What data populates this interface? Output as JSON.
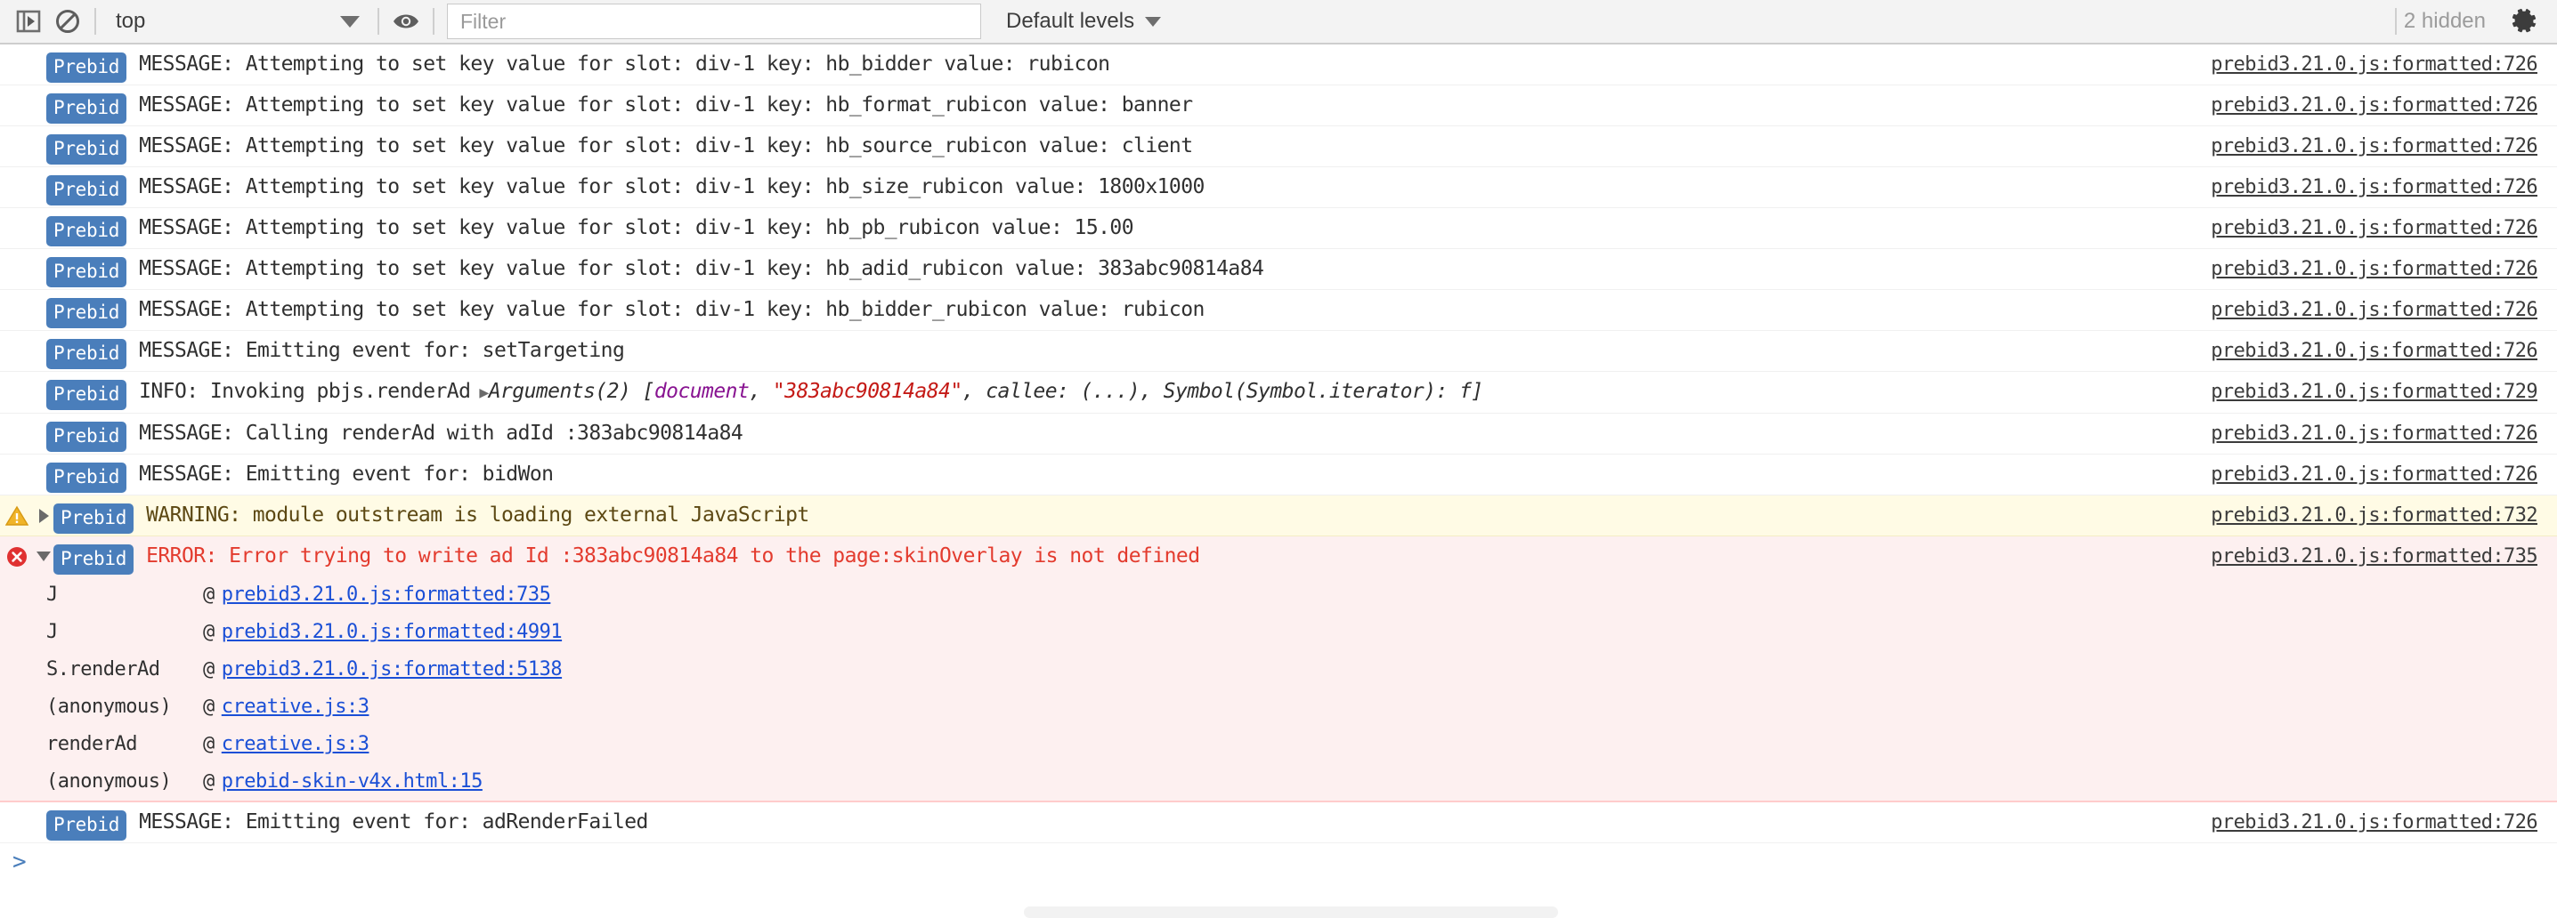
{
  "toolbar": {
    "sidebar_toggle_icon": "panel-open-icon",
    "clear_console_icon": "clear-console-icon",
    "context_value": "top",
    "eye_icon": "live-expression-eye-icon",
    "filter_placeholder": "Filter",
    "filter_value": "",
    "levels_label": "Default levels",
    "hidden_label": "2 hidden",
    "settings_icon": "gear-icon"
  },
  "console": {
    "badge_label": "Prebid",
    "prompt_glyph": ">",
    "rows": [
      {
        "level": "message",
        "text": "MESSAGE: Attempting to set key value for slot: div-1 key: hb_bidder value: rubicon",
        "source": "prebid3.21.0.js:formatted:726"
      },
      {
        "level": "message",
        "text": "MESSAGE: Attempting to set key value for slot: div-1 key: hb_format_rubicon value: banner",
        "source": "prebid3.21.0.js:formatted:726"
      },
      {
        "level": "message",
        "text": "MESSAGE: Attempting to set key value for slot: div-1 key: hb_source_rubicon value: client",
        "source": "prebid3.21.0.js:formatted:726"
      },
      {
        "level": "message",
        "text": "MESSAGE: Attempting to set key value for slot: div-1 key: hb_size_rubicon value: 1800x1000",
        "source": "prebid3.21.0.js:formatted:726"
      },
      {
        "level": "message",
        "text": "MESSAGE: Attempting to set key value for slot: div-1 key: hb_pb_rubicon value: 15.00",
        "source": "prebid3.21.0.js:formatted:726"
      },
      {
        "level": "message",
        "text": "MESSAGE: Attempting to set key value for slot: div-1 key: hb_adid_rubicon value: 383abc90814a84",
        "source": "prebid3.21.0.js:formatted:726"
      },
      {
        "level": "message",
        "text": "MESSAGE: Attempting to set key value for slot: div-1 key: hb_bidder_rubicon value: rubicon",
        "source": "prebid3.21.0.js:formatted:726"
      },
      {
        "level": "message",
        "text": "MESSAGE: Emitting event for: setTargeting",
        "source": "prebid3.21.0.js:formatted:726"
      },
      {
        "level": "info",
        "text": "INFO: Invoking pbjs.renderAd",
        "source": "prebid3.21.0.js:formatted:729",
        "arguments": {
          "expander": "▶",
          "label": "Arguments(2)",
          "open_bracket": "[",
          "prop": "document",
          "comma1": ", ",
          "string": "\"383abc90814a84\"",
          "tail": ", callee: (...), Symbol(Symbol.iterator): f]"
        }
      },
      {
        "level": "message",
        "text": "MESSAGE: Calling renderAd with adId :383abc90814a84",
        "source": "prebid3.21.0.js:formatted:726"
      },
      {
        "level": "message",
        "text": "MESSAGE: Emitting event for: bidWon",
        "source": "prebid3.21.0.js:formatted:726"
      },
      {
        "level": "warning",
        "icon": "warning-triangle-icon",
        "expander": "collapsed",
        "text": "WARNING: module outstream is loading external JavaScript",
        "source": "prebid3.21.0.js:formatted:732"
      },
      {
        "level": "error",
        "icon": "error-circle-icon",
        "expander": "expanded",
        "text": "ERROR: Error trying to write ad Id :383abc90814a84 to the page:skinOverlay is not defined",
        "source": "prebid3.21.0.js:formatted:735"
      },
      {
        "level": "message",
        "text": "MESSAGE: Emitting event for: adRenderFailed",
        "source": "prebid3.21.0.js:formatted:726"
      }
    ],
    "stack_frames": [
      {
        "fn": "J",
        "at": "@",
        "url": "prebid3.21.0.js:formatted:735"
      },
      {
        "fn": "J",
        "at": "@",
        "url": "prebid3.21.0.js:formatted:4991"
      },
      {
        "fn": "S.renderAd",
        "at": "@",
        "url": "prebid3.21.0.js:formatted:5138"
      },
      {
        "fn": "(anonymous)",
        "at": "@",
        "url": "creative.js:3"
      },
      {
        "fn": "renderAd",
        "at": "@",
        "url": "creative.js:3"
      },
      {
        "fn": "(anonymous)",
        "at": "@",
        "url": "prebid-skin-v4x.html:15"
      }
    ]
  },
  "colors": {
    "badge_bg": "#4a7ebb",
    "warning_bg": "#fffbe5",
    "error_bg": "#fdf0f0",
    "error_text": "#e33b2e",
    "link": "#1a4fd6",
    "string_literal": "#c41a16",
    "property": "#881391"
  }
}
